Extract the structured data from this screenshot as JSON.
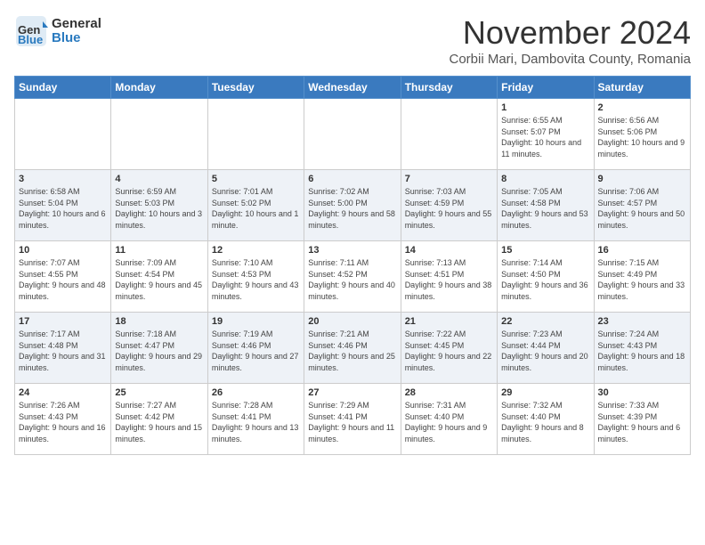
{
  "header": {
    "logo_general": "General",
    "logo_blue": "Blue",
    "month_title": "November 2024",
    "subtitle": "Corbii Mari, Dambovita County, Romania"
  },
  "days_of_week": [
    "Sunday",
    "Monday",
    "Tuesday",
    "Wednesday",
    "Thursday",
    "Friday",
    "Saturday"
  ],
  "weeks": [
    [
      {
        "day": "",
        "info": ""
      },
      {
        "day": "",
        "info": ""
      },
      {
        "day": "",
        "info": ""
      },
      {
        "day": "",
        "info": ""
      },
      {
        "day": "",
        "info": ""
      },
      {
        "day": "1",
        "info": "Sunrise: 6:55 AM\nSunset: 5:07 PM\nDaylight: 10 hours and 11 minutes."
      },
      {
        "day": "2",
        "info": "Sunrise: 6:56 AM\nSunset: 5:06 PM\nDaylight: 10 hours and 9 minutes."
      }
    ],
    [
      {
        "day": "3",
        "info": "Sunrise: 6:58 AM\nSunset: 5:04 PM\nDaylight: 10 hours and 6 minutes."
      },
      {
        "day": "4",
        "info": "Sunrise: 6:59 AM\nSunset: 5:03 PM\nDaylight: 10 hours and 3 minutes."
      },
      {
        "day": "5",
        "info": "Sunrise: 7:01 AM\nSunset: 5:02 PM\nDaylight: 10 hours and 1 minute."
      },
      {
        "day": "6",
        "info": "Sunrise: 7:02 AM\nSunset: 5:00 PM\nDaylight: 9 hours and 58 minutes."
      },
      {
        "day": "7",
        "info": "Sunrise: 7:03 AM\nSunset: 4:59 PM\nDaylight: 9 hours and 55 minutes."
      },
      {
        "day": "8",
        "info": "Sunrise: 7:05 AM\nSunset: 4:58 PM\nDaylight: 9 hours and 53 minutes."
      },
      {
        "day": "9",
        "info": "Sunrise: 7:06 AM\nSunset: 4:57 PM\nDaylight: 9 hours and 50 minutes."
      }
    ],
    [
      {
        "day": "10",
        "info": "Sunrise: 7:07 AM\nSunset: 4:55 PM\nDaylight: 9 hours and 48 minutes."
      },
      {
        "day": "11",
        "info": "Sunrise: 7:09 AM\nSunset: 4:54 PM\nDaylight: 9 hours and 45 minutes."
      },
      {
        "day": "12",
        "info": "Sunrise: 7:10 AM\nSunset: 4:53 PM\nDaylight: 9 hours and 43 minutes."
      },
      {
        "day": "13",
        "info": "Sunrise: 7:11 AM\nSunset: 4:52 PM\nDaylight: 9 hours and 40 minutes."
      },
      {
        "day": "14",
        "info": "Sunrise: 7:13 AM\nSunset: 4:51 PM\nDaylight: 9 hours and 38 minutes."
      },
      {
        "day": "15",
        "info": "Sunrise: 7:14 AM\nSunset: 4:50 PM\nDaylight: 9 hours and 36 minutes."
      },
      {
        "day": "16",
        "info": "Sunrise: 7:15 AM\nSunset: 4:49 PM\nDaylight: 9 hours and 33 minutes."
      }
    ],
    [
      {
        "day": "17",
        "info": "Sunrise: 7:17 AM\nSunset: 4:48 PM\nDaylight: 9 hours and 31 minutes."
      },
      {
        "day": "18",
        "info": "Sunrise: 7:18 AM\nSunset: 4:47 PM\nDaylight: 9 hours and 29 minutes."
      },
      {
        "day": "19",
        "info": "Sunrise: 7:19 AM\nSunset: 4:46 PM\nDaylight: 9 hours and 27 minutes."
      },
      {
        "day": "20",
        "info": "Sunrise: 7:21 AM\nSunset: 4:46 PM\nDaylight: 9 hours and 25 minutes."
      },
      {
        "day": "21",
        "info": "Sunrise: 7:22 AM\nSunset: 4:45 PM\nDaylight: 9 hours and 22 minutes."
      },
      {
        "day": "22",
        "info": "Sunrise: 7:23 AM\nSunset: 4:44 PM\nDaylight: 9 hours and 20 minutes."
      },
      {
        "day": "23",
        "info": "Sunrise: 7:24 AM\nSunset: 4:43 PM\nDaylight: 9 hours and 18 minutes."
      }
    ],
    [
      {
        "day": "24",
        "info": "Sunrise: 7:26 AM\nSunset: 4:43 PM\nDaylight: 9 hours and 16 minutes."
      },
      {
        "day": "25",
        "info": "Sunrise: 7:27 AM\nSunset: 4:42 PM\nDaylight: 9 hours and 15 minutes."
      },
      {
        "day": "26",
        "info": "Sunrise: 7:28 AM\nSunset: 4:41 PM\nDaylight: 9 hours and 13 minutes."
      },
      {
        "day": "27",
        "info": "Sunrise: 7:29 AM\nSunset: 4:41 PM\nDaylight: 9 hours and 11 minutes."
      },
      {
        "day": "28",
        "info": "Sunrise: 7:31 AM\nSunset: 4:40 PM\nDaylight: 9 hours and 9 minutes."
      },
      {
        "day": "29",
        "info": "Sunrise: 7:32 AM\nSunset: 4:40 PM\nDaylight: 9 hours and 8 minutes."
      },
      {
        "day": "30",
        "info": "Sunrise: 7:33 AM\nSunset: 4:39 PM\nDaylight: 9 hours and 6 minutes."
      }
    ]
  ]
}
